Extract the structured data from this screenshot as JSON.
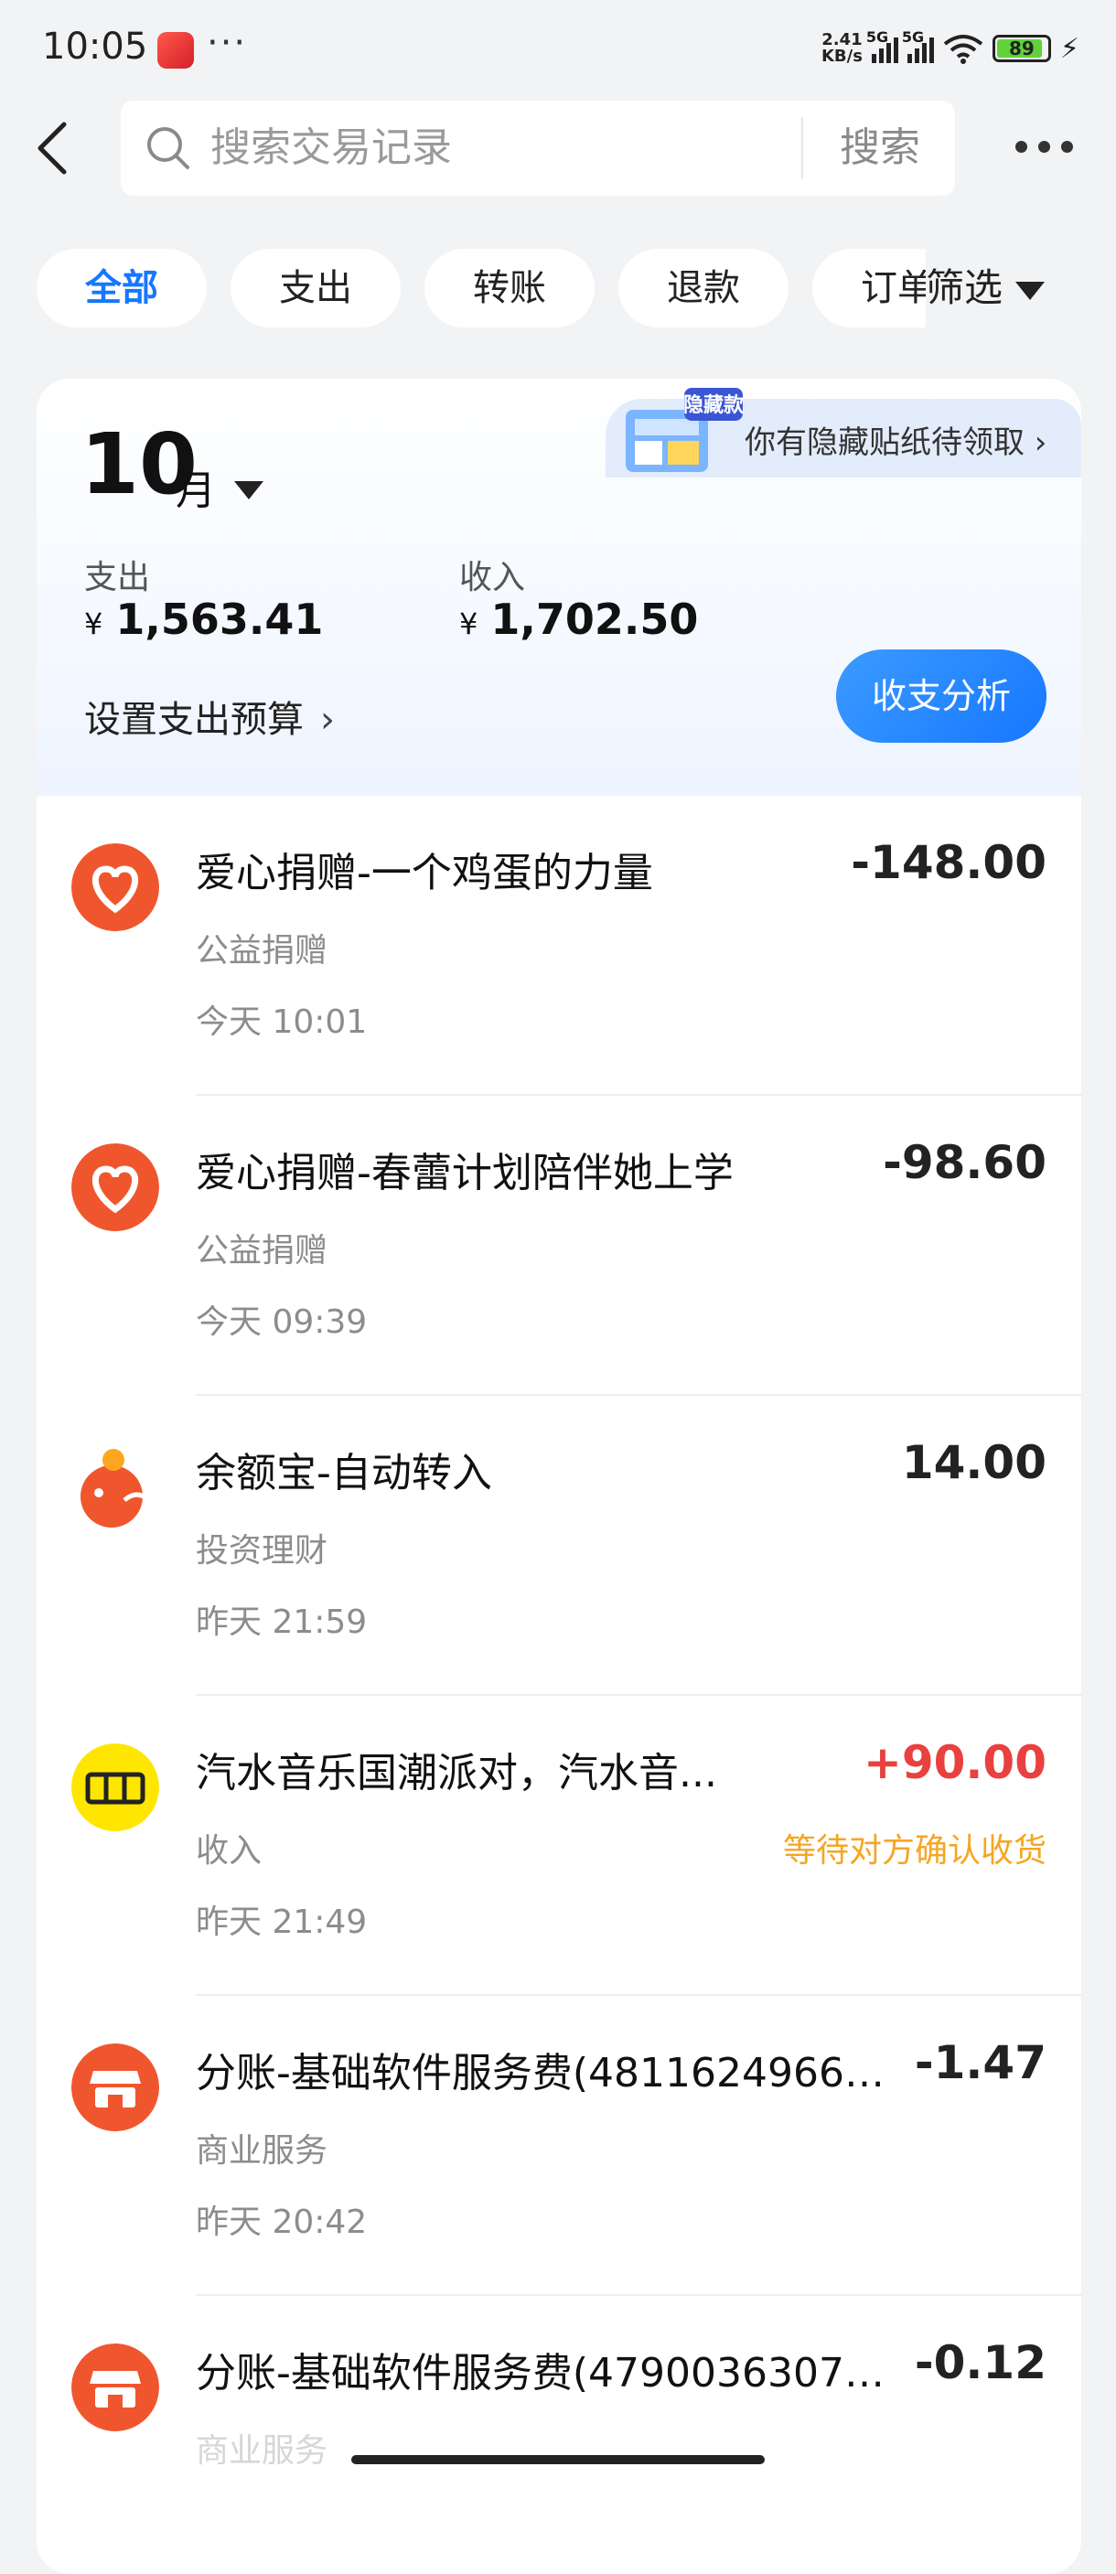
{
  "status": {
    "time": "10:05",
    "dots": "···",
    "net_speed_value": "2.41",
    "net_speed_unit": "KB/s",
    "signal1": "5G",
    "signal2": "5G",
    "battery": "89"
  },
  "header": {
    "search_placeholder": "搜索交易记录",
    "search_button": "搜索"
  },
  "tabs": [
    {
      "label": "全部",
      "active": true
    },
    {
      "label": "支出",
      "active": false
    },
    {
      "label": "转账",
      "active": false
    },
    {
      "label": "退款",
      "active": false
    },
    {
      "label": "订单",
      "active": false
    }
  ],
  "filter_label": "筛选",
  "summary": {
    "banner_badge": "隐藏款",
    "banner_text": "你有隐藏贴纸待领取 ›",
    "month": "10",
    "month_unit": "月",
    "expense_label": "支出",
    "expense_currency": "¥",
    "expense_amount": "1,563.41",
    "income_label": "收入",
    "income_currency": "¥",
    "income_amount": "1,702.50",
    "budget_label": "设置支出预算",
    "analysis_button": "收支分析"
  },
  "transactions": [
    {
      "title": "爱心捐赠-一个鸡蛋的力量",
      "category": "公益捐赠",
      "time": "今天 10:01",
      "amount": "-148.00",
      "note": "",
      "icon": "charity-heart-icon",
      "icon_color": "#f0562d"
    },
    {
      "title": "爱心捐赠-春蕾计划陪伴她上学",
      "category": "公益捐赠",
      "time": "今天 09:39",
      "amount": "-98.60",
      "note": "",
      "icon": "charity-heart-icon",
      "icon_color": "#f0562d"
    },
    {
      "title": "余额宝-自动转入",
      "category": "投资理财",
      "time": "昨天 21:59",
      "amount": "14.00",
      "note": "",
      "icon": "yuebao-icon",
      "icon_color": "#f0562d"
    },
    {
      "title": "汽水音乐国潮派对，汽水音...",
      "category": "收入",
      "time": "昨天 21:49",
      "amount": "+90.00",
      "note": "等待对方确认收货",
      "icon": "xianyu-icon",
      "icon_color": "#ffe600"
    },
    {
      "title": "分账-基础软件服务费(4811624966426...",
      "category": "商业服务",
      "time": "昨天 20:42",
      "amount": "-1.47",
      "note": "",
      "icon": "shop-icon",
      "icon_color": "#f0562d"
    },
    {
      "title": "分账-基础软件服务费(4790036307332...",
      "category": "商业服务",
      "time": "",
      "amount": "-0.12",
      "note": "",
      "icon": "shop-icon",
      "icon_color": "#f0562d"
    }
  ],
  "colors": {
    "accent": "#1677ff",
    "income": "#e8413f",
    "pending": "#f5a623"
  }
}
